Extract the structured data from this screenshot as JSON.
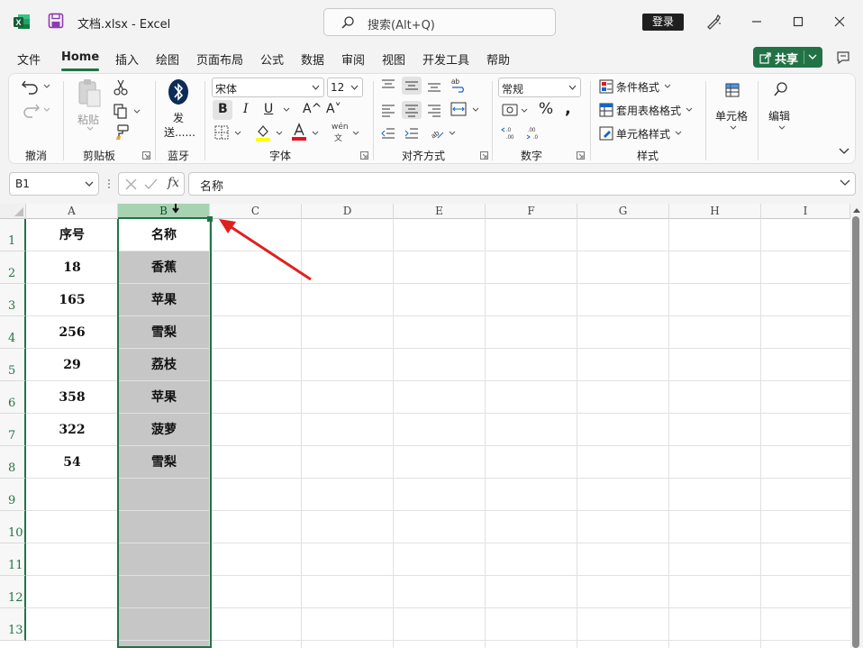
{
  "titlebar": {
    "doc_title": "文档.xlsx  -  Excel",
    "search_placeholder": "搜索(Alt+Q)",
    "login_label": "登录"
  },
  "menu": {
    "tabs": [
      "文件",
      "Home",
      "插入",
      "绘图",
      "页面布局",
      "公式",
      "数据",
      "审阅",
      "视图",
      "开发工具",
      "帮助"
    ],
    "active": "Home",
    "share_label": "共享"
  },
  "ribbon": {
    "undo_group": "撤消",
    "clipboard": {
      "paste": "粘贴",
      "label": "剪贴板"
    },
    "bluetooth": {
      "send": "发",
      "send2": "送......",
      "label": "蓝牙"
    },
    "font": {
      "name": "宋体",
      "size": "12",
      "label": "字体",
      "bold": "B",
      "italic": "I",
      "underline": "U",
      "grow": "A^",
      "shrink": "A˅",
      "phonetic_top": "wén",
      "phonetic_bottom": "文"
    },
    "alignment": {
      "label": "对齐方式"
    },
    "number": {
      "format": "常规",
      "label": "数字"
    },
    "styles": {
      "conditional": "条件格式",
      "table": "套用表格格式",
      "cell": "单元格样式",
      "label": "样式"
    },
    "cells_label": "单元格",
    "editing_label": "编辑"
  },
  "formula_bar": {
    "name_box": "B1",
    "fx": "fx",
    "content": "名称"
  },
  "sheet": {
    "columns": [
      "A",
      "B",
      "C",
      "D",
      "E",
      "F",
      "G",
      "H",
      "I"
    ],
    "selected_column": "B",
    "rows": [
      "1",
      "2",
      "3",
      "4",
      "5",
      "6",
      "7",
      "8",
      "9",
      "10",
      "11",
      "12",
      "13"
    ],
    "colA": [
      "序号",
      "18",
      "165",
      "256",
      "29",
      "358",
      "322",
      "54"
    ],
    "colB": [
      "名称",
      "香蕉",
      "苹果",
      "雪梨",
      "荔枝",
      "苹果",
      "菠萝",
      "雪梨"
    ]
  },
  "colors": {
    "accent": "#217346",
    "selected_header": "#a7d3b3",
    "selection_fill": "#c6c6c6",
    "arrow": "#e02020"
  }
}
